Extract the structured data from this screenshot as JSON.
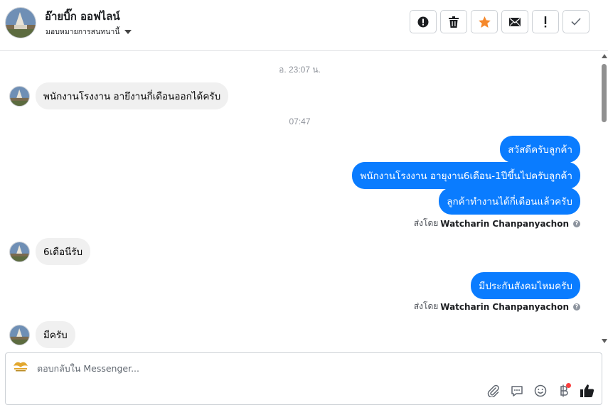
{
  "header": {
    "contact_name": "อ๊ายบิ๊ก ออฟไลน์",
    "assign_label": "มอบหมายการสนทนานี้"
  },
  "toolbar": {
    "icons": [
      "alert-icon",
      "trash-icon",
      "star-icon",
      "mail-icon",
      "exclamation-icon",
      "check-icon"
    ],
    "accent_color": "#f5882b"
  },
  "conversation": {
    "timestamp_1": "อ. 23:07 น.",
    "timestamp_2": "07:47",
    "msg_in_1": "พนักงานโรงงาน อายึงานกี่เดือนออกได้ครับ",
    "msg_out_1": "สวัสดีครับลูกค้า",
    "msg_out_2": "พนักงานโรงงาน อายุงาน6เดือน-1ปีขึ้นไปครับลูกค้า",
    "msg_out_3": "ลูกค้าทำงานได้กี่เดือนแล้วครับ",
    "sent_by_prefix": "ส่งโดย",
    "sent_by_name": "Watcharin Chanpanyachon",
    "msg_in_2": "6เดือนีรับ",
    "msg_out_4": "มีประกันสังคมไหมครับ",
    "msg_in_3": "มีครับ",
    "bubble_out_color": "#0a7cff",
    "bubble_in_color": "#f0f0f0"
  },
  "composer": {
    "placeholder": "ตอบกลับใน Messenger...",
    "icons": [
      "paperclip-icon",
      "chat-icon",
      "smiley-icon",
      "baht-icon",
      "thumbs-up-icon"
    ]
  }
}
